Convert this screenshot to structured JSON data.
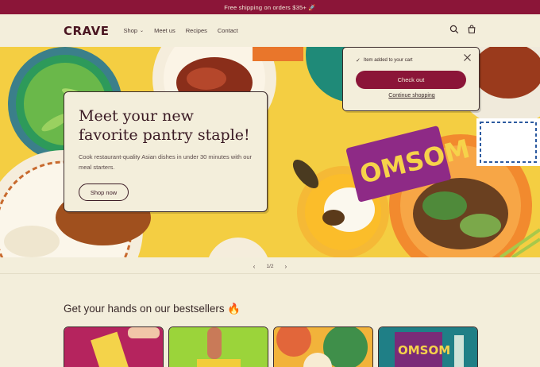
{
  "announcement": "Free shipping on orders $35+ 🚀",
  "header": {
    "logo": "CRAVE",
    "nav": [
      "Shop",
      "Meet us",
      "Recipes",
      "Contact"
    ],
    "icons": [
      "search-icon",
      "cart-icon"
    ]
  },
  "hero": {
    "title": "Meet your new favorite pantry staple!",
    "subtitle": "Cook restaurant-quality Asian dishes in under 30 minutes with our meal starters.",
    "button": "Shop now",
    "pack_text": "OMSOM"
  },
  "slider": {
    "counter": "1/2"
  },
  "bestsellers": {
    "title": "Get your hands on our bestsellers 🔥",
    "product_pack_text": "OMSOM"
  },
  "cart_popup": {
    "message": "Item added to your cart",
    "checkout": "Check out",
    "continue": "Continue shopping"
  },
  "colors": {
    "brand": "#8b1538",
    "background": "#f3eedb",
    "hero_yellow": "#f2c93a"
  }
}
